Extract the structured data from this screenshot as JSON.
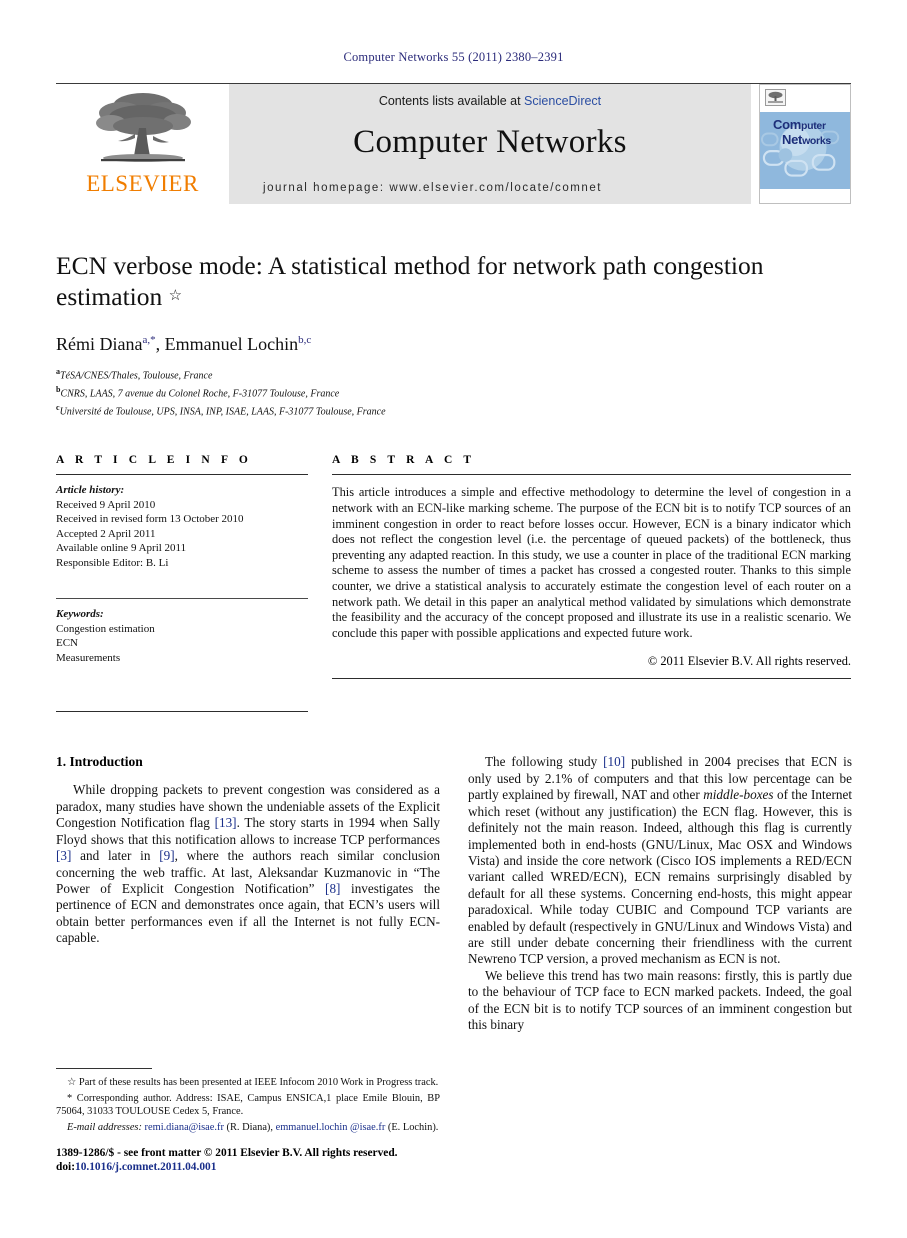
{
  "running_head": "Computer Networks 55 (2011) 2380–2391",
  "masthead": {
    "publisher_name": "ELSEVIER",
    "contents_prefix": "Contents lists available at ",
    "contents_link": "ScienceDirect",
    "journal_name": "Computer Networks",
    "homepage": "journal homepage: www.elsevier.com/locate/comnet",
    "cover": {
      "title_line1_bold": "Com",
      "title_line1_rest": "puter",
      "title_line2_bold": "Net",
      "title_line2_rest": "works"
    }
  },
  "article": {
    "title": "ECN verbose mode: A statistical method for network path congestion estimation",
    "title_star": "☆",
    "authors": "Rémi Diana, Emmanuel Lochin",
    "author1_name": "Rémi Diana",
    "author1_sup": "a,*",
    "author_sep": ", ",
    "author2_name": "Emmanuel Lochin",
    "author2_sup": "b,c",
    "affiliations": [
      {
        "marker": "a",
        "text": "TéSA/CNES/Thales, Toulouse, France"
      },
      {
        "marker": "b",
        "text": "CNRS, LAAS, 7 avenue du Colonel Roche, F-31077 Toulouse, France"
      },
      {
        "marker": "c",
        "text": "Université de Toulouse, UPS, INSA, INP, ISAE, LAAS, F-31077 Toulouse, France"
      }
    ]
  },
  "info": {
    "heading": "A R T I C L E  I N F O",
    "history_label": "Article history:",
    "history": [
      "Received 9 April 2010",
      "Received in revised form 13 October 2010",
      "Accepted 2 April 2011",
      "Available online 9 April 2011",
      "Responsible Editor: B. Li"
    ],
    "keywords_label": "Keywords:",
    "keywords": [
      "Congestion estimation",
      "ECN",
      "Measurements"
    ]
  },
  "abstract": {
    "heading": "A B S T R A C T",
    "text": "This article introduces a simple and effective methodology to determine the level of congestion in a network with an ECN-like marking scheme. The purpose of the ECN bit is to notify TCP sources of an imminent congestion in order to react before losses occur. However, ECN is a binary indicator which does not reflect the congestion level (i.e. the percentage of queued packets) of the bottleneck, thus preventing any adapted reaction. In this study, we use a counter in place of the traditional ECN marking scheme to assess the number of times a packet has crossed a congested router. Thanks to this simple counter, we drive a statistical analysis to accurately estimate the congestion level of each router on a network path. We detail in this paper an analytical method validated by simulations which demonstrate the feasibility and the accuracy of the concept proposed and illustrate its use in a realistic scenario. We conclude this paper with possible applications and expected future work.",
    "copyright": "© 2011 Elsevier B.V. All rights reserved."
  },
  "body": {
    "section_title": "1. Introduction",
    "left_paragraph_1": {
      "p1": "While dropping packets to prevent congestion was considered as a paradox, many studies have shown the undeniable assets of the Explicit Congestion Notification flag ",
      "c1": "[13]",
      "p2": ". The story starts in 1994 when Sally Floyd shows that this notification allows to increase TCP performances ",
      "c2": "[3]",
      "p3": " and later in ",
      "c3": "[9]",
      "p4": ", where the authors reach similar conclusion concerning the web traffic. At last, Aleksandar Kuzmanovic in “The Power of Explicit Congestion Notification” ",
      "c4": "[8]",
      "p5": " investigates the pertinence of ECN and demonstrates once again, that ECN’s users will obtain better performances even if all the Internet is not fully ECN-capable."
    },
    "right_paragraph_1": {
      "p1": "The following study ",
      "c1": "[10]",
      "p2": " published in 2004 precises that ECN is only used by 2.1% of computers and that this low percentage can be partly explained by firewall, NAT and other ",
      "i1": "middle-boxes",
      "p3": " of the Internet which reset (without any justification) the ECN flag. However, this is definitely not the main reason. Indeed, although this flag is currently implemented both in end-hosts (GNU/Linux, Mac OSX and Windows Vista) and inside the core network (Cisco IOS implements a RED/ECN variant called WRED/ECN), ECN remains surprisingly disabled by default for all these systems. Concerning end-hosts, this might appear paradoxical. While today CUBIC and Compound TCP variants are enabled by default (respectively in GNU/Linux and Windows Vista) and are still under debate concerning their friendliness with the current Newreno TCP version, a proved mechanism as ECN is not."
    },
    "right_paragraph_2": "We believe this trend has two main reasons: firstly, this is partly due to the behaviour of TCP face to ECN marked packets. Indeed, the goal of the ECN bit is to notify TCP sources of an imminent congestion but this binary"
  },
  "footnotes": {
    "star_note": "☆ Part of these results has been presented at IEEE Infocom 2010 Work in Progress track.",
    "corresponding_note": "* Corresponding author. Address: ISAE, Campus ENSICA,1 place Emile Blouin, BP 75064, 31033 TOULOUSE Cedex 5, France.",
    "email_label": "E-mail addresses:",
    "email1": "remi.diana@isae.fr",
    "email1_owner": " (R. Diana), ",
    "email2": "emmanuel.lochin @isae.fr",
    "email2_owner": " (E. Lochin).",
    "frontmatter": "1389-1286/$ - see front matter © 2011 Elsevier B.V. All rights reserved.",
    "doi_label": "doi:",
    "doi": "10.1016/j.comnet.2011.04.001"
  }
}
